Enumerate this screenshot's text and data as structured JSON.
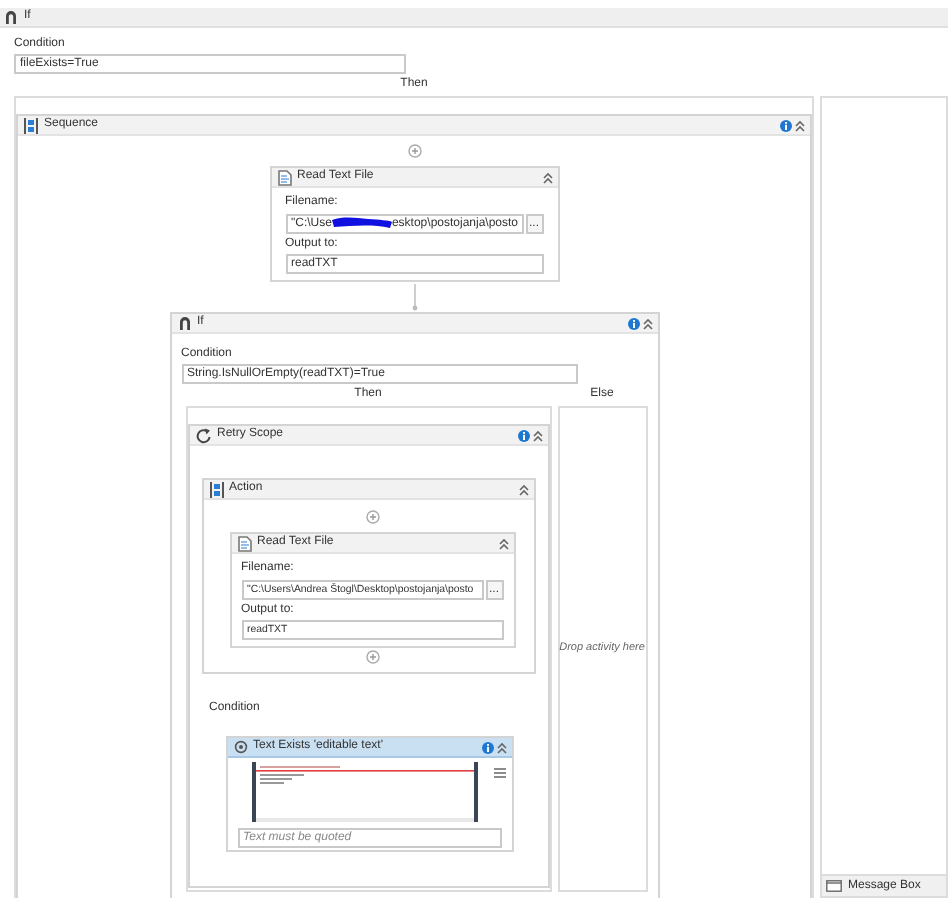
{
  "outer_if": {
    "title": "If",
    "condition_label": "Condition",
    "condition": "fileExists=True",
    "then_label": "Then",
    "sequence": {
      "title": "Sequence",
      "read_text_file": {
        "title": "Read Text File",
        "filename_label": "Filename:",
        "filename_start": "\"C:\\Use",
        "filename_end": "esktop\\postojanja\\posto",
        "browse": "...",
        "output_label": "Output to:",
        "output": "readTXT"
      },
      "inner_if": {
        "title": "If",
        "condition_label": "Condition",
        "condition": "String.IsNullOrEmpty(readTXT)=True",
        "then_label": "Then",
        "else_label": "Else",
        "else_placeholder": "Drop activity here",
        "retry_scope": {
          "title": "Retry Scope",
          "action": {
            "title": "Action",
            "read_text_file": {
              "title": "Read Text File",
              "filename_label": "Filename:",
              "filename": "\"C:\\Users\\Andrea Štogl\\Desktop\\postojanja\\posto",
              "browse": "...",
              "output_label": "Output to:",
              "output": "readTXT"
            }
          },
          "condition_label": "Condition",
          "text_exists": {
            "title": "Text Exists 'editable text'",
            "selected": true,
            "text_placeholder": "Text must be quoted"
          }
        }
      }
    }
  },
  "side_panel": {
    "item": "Message Box"
  }
}
